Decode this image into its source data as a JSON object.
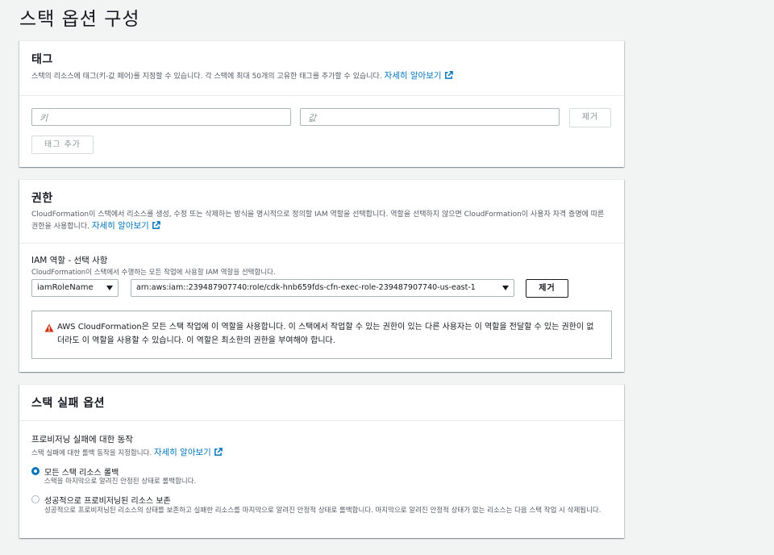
{
  "page": {
    "title": "스택 옵션 구성"
  },
  "tags": {
    "title": "태그",
    "description": "스택의 리소스에 태그(키-값 페어)를 지정할 수 있습니다. 각 스택에 최대 50개의 고유한 태그를 추가할 수 있습니다.",
    "learn_more": "자세히 알아보기",
    "key_placeholder": "키",
    "value_placeholder": "값",
    "remove_label": "제거",
    "add_label": "태그 추가"
  },
  "permissions": {
    "title": "권한",
    "description": "CloudFormation이 스택에서 리소스를 생성, 수정 또는 삭제하는 방식을 명시적으로 정의할 IAM 역할을 선택합니다. 역할을 선택하지 않으면 CloudFormation이 사용자 자격 증명에 따른 권한을 사용합니다.",
    "learn_more": "자세히 알아보기",
    "iam_label": "IAM 역할 - 선택 사항",
    "iam_desc": "CloudFormation이 스택에서 수행하는 모든 작업에 사용할 IAM 역할을 선택합니다.",
    "role_type_value": "iamRoleName",
    "role_arn_value": "arn:aws:iam::239487907740:role/cdk-hnb659fds-cfn-exec-role-239487907740-us-east-1",
    "remove_label": "제거",
    "warning": "AWS CloudFormation은 모든 스택 작업에 이 역할을 사용합니다. 이 스택에서 작업할 수 있는 권한이 있는 다른 사용자는 이 역할을 전달할 수 있는 권한이 없더라도 이 역할을 사용할 수 있습니다. 이 역할은 최소한의 권한을 부여해야 합니다."
  },
  "failure": {
    "title": "스택 실패 옵션",
    "behavior_label": "프로비저닝 실패에 대한 동작",
    "behavior_desc": "스택 실패에 대한 롤백 동작을 지정합니다.",
    "learn_more": "자세히 알아보기",
    "options": [
      {
        "label": "모든 스택 리소스 롤백",
        "desc": "스택을 마지막으로 알려진 안정된 상태로 롤백합니다.",
        "checked": true
      },
      {
        "label": "성공적으로 프로비저닝된 리소스 보존",
        "desc": "성공적으로 프로비저닝된 리소스의 상태를 보존하고 실패한 리소스를 마지막으로 알려진 안정적 상태로 롤백합니다. 마지막으로 알려진 안정적 상태가 없는 리소스는 다음 스택 작업 시 삭제됩니다.",
        "checked": false
      }
    ]
  },
  "colors": {
    "link": "#0073bb",
    "warning": "#d13212",
    "background": "#f2f3f3"
  },
  "icons": {
    "external": "external-link-icon",
    "warning": "warning-icon",
    "caret": "caret-down-icon"
  }
}
